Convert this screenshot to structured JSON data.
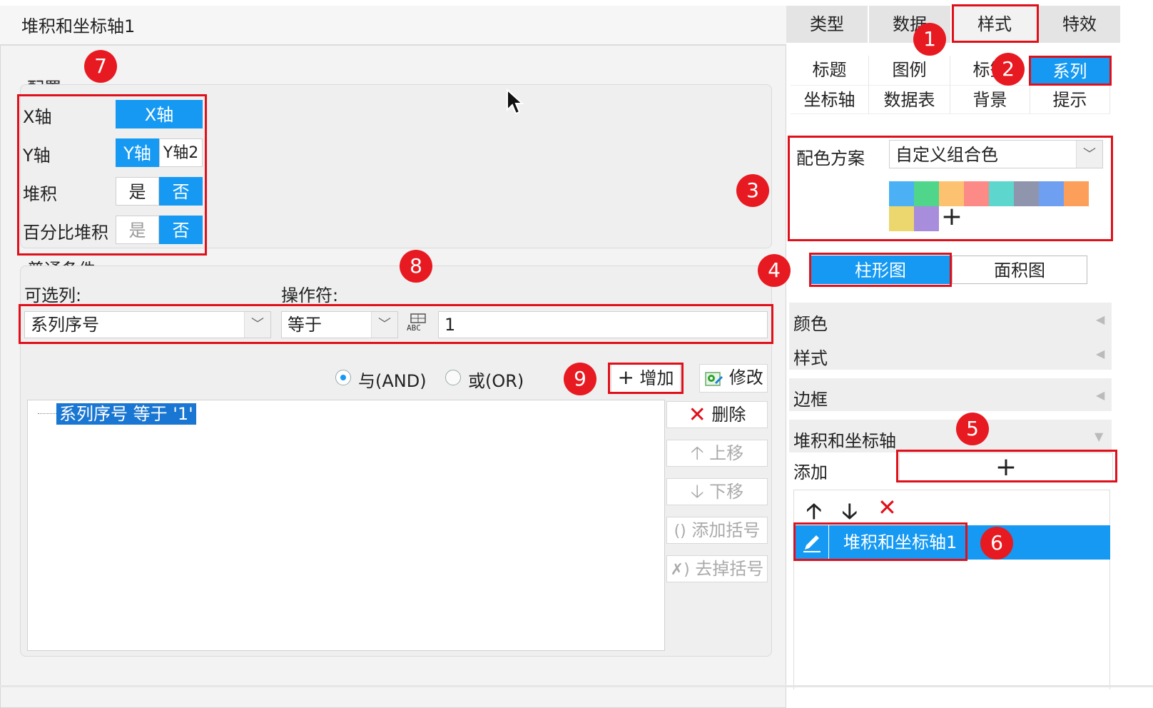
{
  "dialog": {
    "title": "堆积和坐标轴1",
    "config": {
      "label": "配置:",
      "x_axis": {
        "label": "X轴",
        "options": [
          "X轴"
        ],
        "selected": 0
      },
      "y_axis": {
        "label": "Y轴",
        "options": [
          "Y轴",
          "Y轴2"
        ],
        "selected": 0
      },
      "stack": {
        "label": "堆积",
        "options": [
          "是",
          "否"
        ],
        "selected": 1
      },
      "percent_stack": {
        "label": "百分比堆积",
        "options": [
          "是",
          "否"
        ],
        "selected": 1
      }
    },
    "condition": {
      "group_label": "普通条件",
      "column_label": "可选列:",
      "operator_label": "操作符:",
      "column_value": "系列序号",
      "operator_value": "等于",
      "value_type_icon": "ABC",
      "value": "1",
      "and_label": "与(AND)",
      "or_label": "或(OR)",
      "logic_selected": "AND",
      "add_label": "增加",
      "modify_label": "修改",
      "list": [
        "系列序号 等于 '1'"
      ],
      "delete_label": "删除",
      "move_up_label": "上移",
      "move_down_label": "下移",
      "add_paren_label": "添加括号",
      "remove_paren_label": "去掉括号"
    }
  },
  "right_panel": {
    "tabs": [
      "类型",
      "数据",
      "样式",
      "特效"
    ],
    "active_tab": 2,
    "sub_tabs_row1": [
      "标题",
      "图例",
      "标签",
      "系列"
    ],
    "sub_tabs_row2": [
      "坐标轴",
      "数据表",
      "背景",
      "提示"
    ],
    "active_sub_tab": "系列",
    "color_scheme_label": "配色方案",
    "color_scheme_value": "自定义组合色",
    "colors": [
      "#4bb1f4",
      "#4fd68a",
      "#fdc26f",
      "#fc8a86",
      "#5dd7cd",
      "#8e95ad",
      "#6e9ff0",
      "#fb9f5a",
      "#ecd66e",
      "#a78ddb"
    ],
    "add_color_symbol": "+",
    "chart_types": [
      "柱形图",
      "面积图"
    ],
    "active_chart_type": 0,
    "sections": [
      "颜色",
      "样式",
      "边框",
      "堆积和坐标轴"
    ],
    "add_label": "添加",
    "add_symbol": "+",
    "items": [
      "堆积和坐标轴1"
    ]
  },
  "badges": [
    "1",
    "2",
    "3",
    "4",
    "5",
    "6",
    "7",
    "8",
    "9"
  ]
}
